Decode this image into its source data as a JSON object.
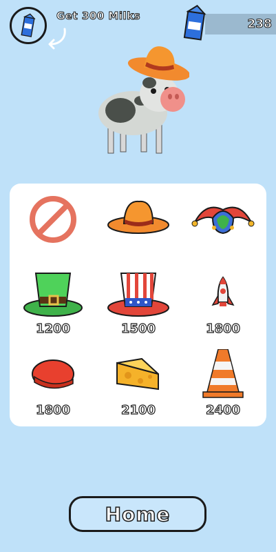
{
  "goal": {
    "text": "Get 300 Milks",
    "icon": "milk-carton-icon"
  },
  "currency": {
    "value": "238",
    "icon": "milk-carton-icon"
  },
  "shop": {
    "items": [
      {
        "name": "none",
        "icon": "no-hat-icon",
        "price": ""
      },
      {
        "name": "cowboy-hat",
        "icon": "cowboy-hat-icon",
        "price": ""
      },
      {
        "name": "jester-hat",
        "icon": "jester-hat-icon",
        "price": ""
      },
      {
        "name": "leprechaun-hat",
        "icon": "green-top-hat-icon",
        "price": "1200"
      },
      {
        "name": "uncle-sam-hat",
        "icon": "uncle-sam-hat-icon",
        "price": "1500"
      },
      {
        "name": "rocket",
        "icon": "rocket-icon",
        "price": "1800"
      },
      {
        "name": "beret",
        "icon": "beret-icon",
        "price": "1800"
      },
      {
        "name": "cheese",
        "icon": "cheese-icon",
        "price": "2100"
      },
      {
        "name": "traffic-cone",
        "icon": "traffic-cone-icon",
        "price": "2400"
      }
    ]
  },
  "home_button": {
    "label": "Home"
  },
  "colors": {
    "background": "#bfe1f9",
    "panel": "#ffffff",
    "accent": "#f08a2c"
  }
}
